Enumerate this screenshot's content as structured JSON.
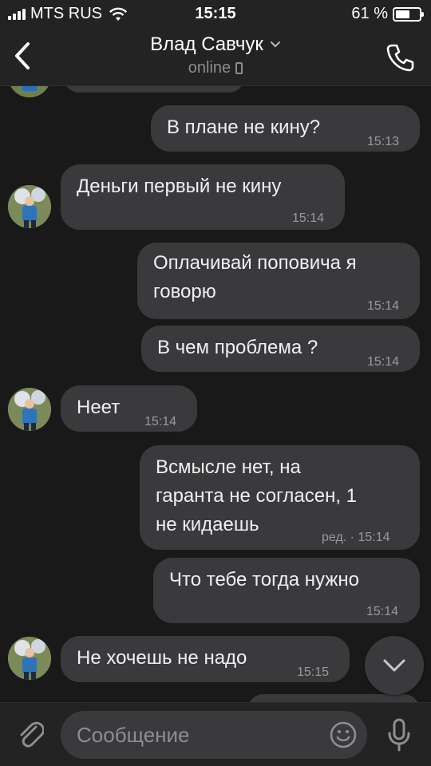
{
  "status_bar": {
    "carrier": "MTS RUS",
    "time": "15:15",
    "battery": "61 %",
    "battery_level": 0.61
  },
  "header": {
    "title": "Влад Савчук",
    "subtitle": "online"
  },
  "messages": [
    {
      "text": "В плане не кину?",
      "time": "15:13"
    },
    {
      "text": "Деньги первый не кину",
      "time": "15:14"
    },
    {
      "text": "Оплачивай поповича я\nговорю",
      "time": "15:14"
    },
    {
      "text": "В чем проблема ?",
      "time": "15:14"
    },
    {
      "text": "Неет",
      "time": "15:14"
    },
    {
      "text": "Всмысле нет, на\nгаранта не согласен, 1\nне кидаешь",
      "time": "ред. · 15:14"
    },
    {
      "text": "Что тебе тогда нужно",
      "time": "15:14"
    },
    {
      "text": "Не хочешь не надо",
      "time": "15:15"
    }
  ],
  "input": {
    "placeholder": "Сообщение"
  },
  "colors": {
    "background": "#19191a",
    "bar": "#232324",
    "bubble": "#3a3a3c",
    "text": "#f0f0f2",
    "muted": "#9a9a9e"
  }
}
